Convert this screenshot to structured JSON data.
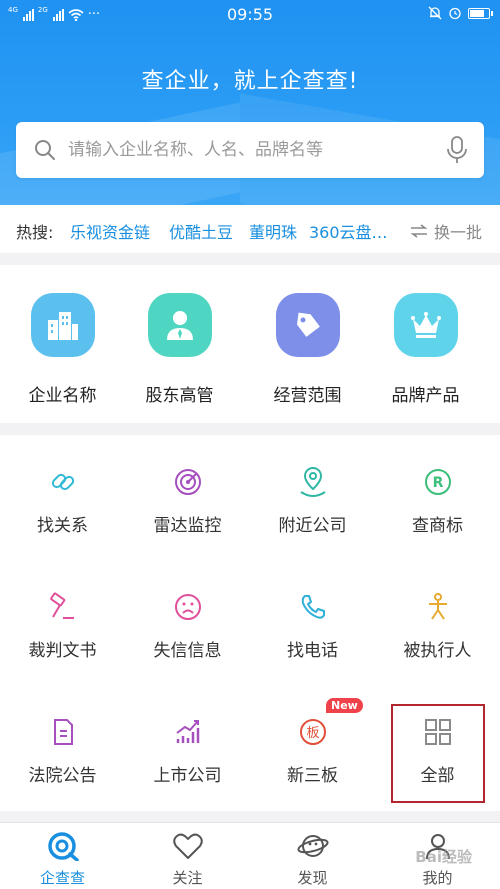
{
  "status_bar": {
    "network_1": "4G",
    "network_2": "2G",
    "more": "···",
    "time": "09:55"
  },
  "header": {
    "slogan": "查企业，就上企查查!",
    "search_placeholder": "请输入企业名称、人名、品牌名等"
  },
  "hot_search": {
    "label": "热搜:",
    "keywords": [
      "乐视资金链",
      "优酷土豆",
      "董明珠",
      "360云盘…"
    ],
    "refresh_label": "换一批"
  },
  "categories": [
    {
      "label": "企业名称",
      "icon": "building-icon",
      "color": "#5cc0ee"
    },
    {
      "label": "股东高管",
      "icon": "person-icon",
      "color": "#4fd6c2"
    },
    {
      "label": "经营范围",
      "icon": "tag-icon",
      "color": "#7d8fe8"
    },
    {
      "label": "品牌产品",
      "icon": "crown-icon",
      "color": "#5fd3ea"
    }
  ],
  "tools": [
    {
      "label": "找关系",
      "icon": "link-icon",
      "color": "#2fb9d6"
    },
    {
      "label": "雷达监控",
      "icon": "radar-icon",
      "color": "#a64fbf"
    },
    {
      "label": "附近公司",
      "icon": "location-icon",
      "color": "#2fb7a4"
    },
    {
      "label": "查商标",
      "icon": "trademark-icon",
      "color": "#3cbf7a"
    },
    {
      "label": "裁判文书",
      "icon": "gavel-icon",
      "color": "#e0509a"
    },
    {
      "label": "失信信息",
      "icon": "sad-face-icon",
      "color": "#e0509a"
    },
    {
      "label": "找电话",
      "icon": "phone-icon",
      "color": "#2fb0d6"
    },
    {
      "label": "被执行人",
      "icon": "person-executed-icon",
      "color": "#e8a92f"
    },
    {
      "label": "法院公告",
      "icon": "notice-icon",
      "color": "#a64fbf"
    },
    {
      "label": "上市公司",
      "icon": "chart-up-icon",
      "color": "#a64fbf"
    },
    {
      "label": "新三板",
      "icon": "board-icon",
      "color": "#e0503a"
    },
    {
      "label": "全部",
      "icon": "grid-icon",
      "color": "#8a8a8a"
    }
  ],
  "new_badge": "New",
  "tabbar": [
    {
      "label": "企查查",
      "icon": "qichacha-logo-icon",
      "active": true
    },
    {
      "label": "关注",
      "icon": "heart-icon",
      "active": false
    },
    {
      "label": "发现",
      "icon": "planet-icon",
      "active": false
    },
    {
      "label": "我的",
      "icon": "user-icon",
      "active": false
    }
  ],
  "watermark": "Bai经验"
}
